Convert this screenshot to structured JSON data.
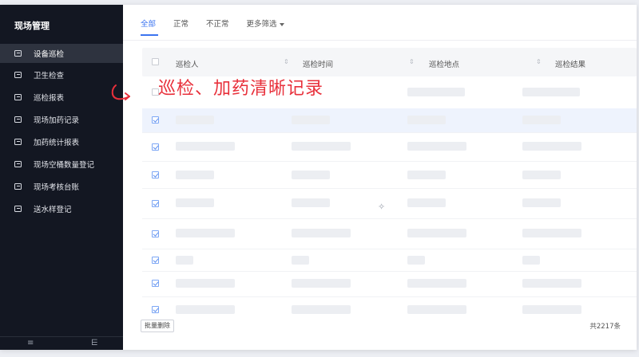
{
  "sidebar": {
    "title": "现场管理",
    "items": [
      {
        "label": "设备巡检",
        "active": true
      },
      {
        "label": "卫生检查",
        "active": false
      },
      {
        "label": "巡检报表",
        "active": false
      },
      {
        "label": "现场加药记录",
        "active": false
      },
      {
        "label": "加药统计报表",
        "active": false
      },
      {
        "label": "现场空桶数量登记",
        "active": false
      },
      {
        "label": "现场考核台账",
        "active": false
      },
      {
        "label": "送水样登记",
        "active": false
      }
    ],
    "footer": {
      "left_glyph": "≡",
      "right_glyph": "⋿"
    }
  },
  "tabs": [
    {
      "label": "全部",
      "active": true
    },
    {
      "label": "正常",
      "active": false
    },
    {
      "label": "不正常",
      "active": false
    },
    {
      "label": "更多筛选",
      "active": false,
      "dropdown": true
    }
  ],
  "table": {
    "columns": [
      "巡检人",
      "巡检时间",
      "巡检地点",
      "巡检结果"
    ],
    "sort_glyph": "⇕",
    "header_checked": false,
    "rows": [
      {
        "checked": false,
        "highlight": false,
        "loading": true
      },
      {
        "checked": true,
        "highlight": true,
        "loading": true
      },
      {
        "checked": true,
        "highlight": false,
        "loading": true
      },
      {
        "checked": true,
        "highlight": false,
        "loading": true
      },
      {
        "checked": true,
        "highlight": false,
        "loading": true
      },
      {
        "checked": true,
        "highlight": false,
        "loading": true
      },
      {
        "checked": true,
        "highlight": false,
        "loading": true
      },
      {
        "checked": true,
        "highlight": false,
        "loading": true
      },
      {
        "checked": true,
        "highlight": false,
        "loading": true
      }
    ]
  },
  "batch_delete_label": "批量删除",
  "total_label": "共2217条",
  "annotation": {
    "text": "巡检、加药清晰记录",
    "color": "#e8303b"
  },
  "colors": {
    "accent": "#3b74f0",
    "sidebar_bg": "#131722"
  }
}
